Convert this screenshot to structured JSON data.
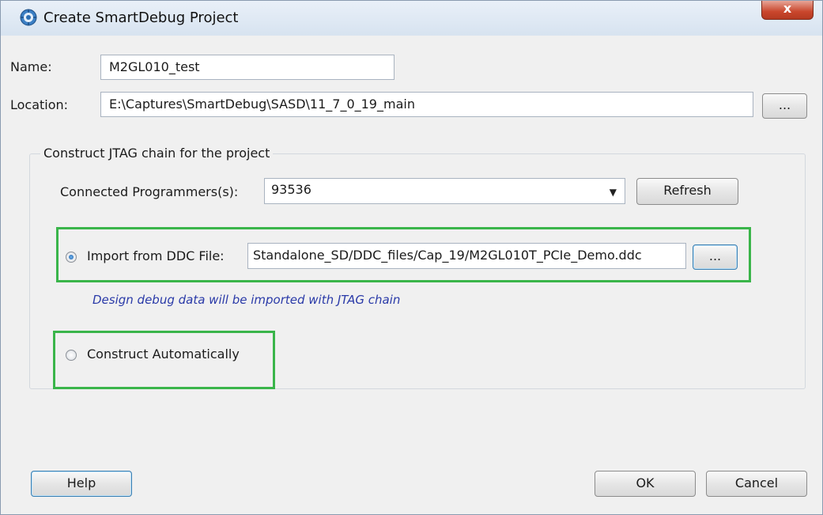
{
  "window": {
    "title": "Create SmartDebug Project",
    "close_glyph": "x"
  },
  "form": {
    "name_label": "Name:",
    "name_value": "M2GL010_test",
    "location_label": "Location:",
    "location_value": "E:\\Captures\\SmartDebug\\SASD\\11_7_0_19_main",
    "browse_label": "..."
  },
  "jtag": {
    "group_title": "Construct JTAG chain for the project",
    "programmers_label": "Connected Programmers(s):",
    "programmer_selected": "93536",
    "refresh_label": "Refresh",
    "import_label": "Import from DDC File:",
    "import_path": "Standalone_SD/DDC_files/Cap_19/M2GL010T_PCIe_Demo.ddc",
    "import_browse_label": "...",
    "import_selected": true,
    "note": "Design debug data will be imported with JTAG chain",
    "auto_label": "Construct Automatically",
    "auto_selected": false
  },
  "footer": {
    "help_label": "Help",
    "ok_label": "OK",
    "cancel_label": "Cancel"
  },
  "colors": {
    "highlight": "#3ab54a",
    "note_text": "#2a3aa8",
    "close_button": "#c9462c"
  }
}
